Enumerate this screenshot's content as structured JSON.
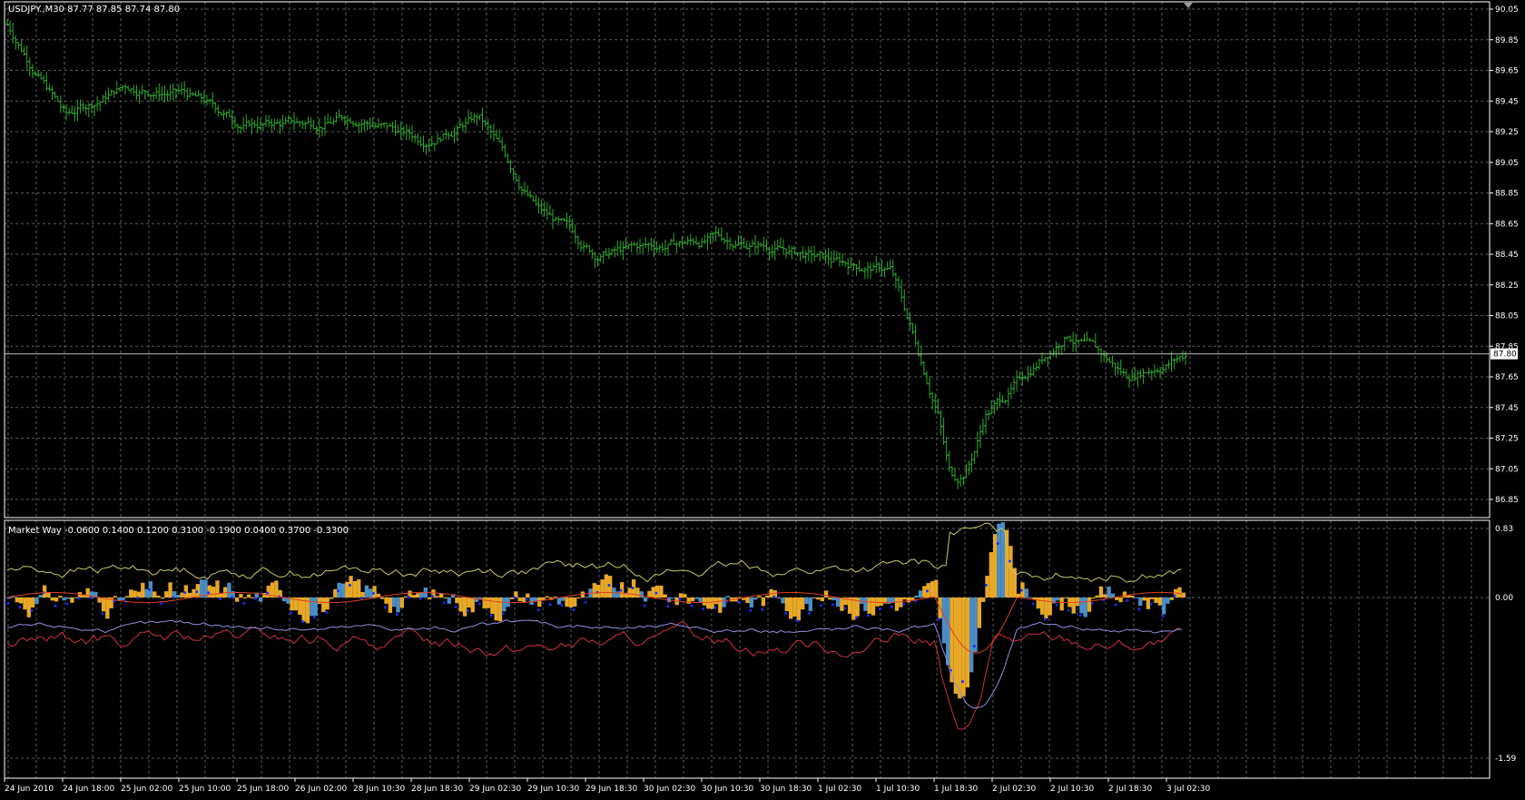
{
  "window": {
    "title": "USDJPY.,M30  87.77 87.85 87.74 87.80",
    "symbol": "USDJPY.,M30",
    "ohlc_text": "87.77 87.85 87.74 87.80"
  },
  "colors": {
    "background": "#000000",
    "grid": "#5a5a5a",
    "frame": "#ffffff",
    "bar": "#2ea82e",
    "current_price_line": "#c0c0c0",
    "hist_orange": "#e8a826",
    "hist_blue": "#4a8ec8",
    "dots": "#1a2cff",
    "line_yellow": "#c8c86a",
    "line_red": "#d03040",
    "line_orange_red": "#e04020",
    "line_purple": "#9090e0"
  },
  "price_pane": {
    "y_axis_labels": [
      "90.05",
      "89.85",
      "89.65",
      "89.45",
      "89.25",
      "89.05",
      "88.85",
      "88.65",
      "88.45",
      "88.25",
      "88.05",
      "87.85",
      "87.65",
      "87.45",
      "87.25",
      "87.05",
      "86.85"
    ],
    "current_price_label": "87.80",
    "current_price": 87.8
  },
  "indicator_pane": {
    "label": "Market Way -0.0600 0.1400 0.1200 0.3100 -0.1900 0.0400 0.3700 -0.3300",
    "y_axis_labels": [
      "0.83",
      "0.00",
      "-1.59"
    ],
    "max": 0.83,
    "min": -1.59
  },
  "time_axis": {
    "labels": [
      "24 Jun 2010",
      "24 Jun 18:00",
      "25 Jun 02:00",
      "25 Jun 10:00",
      "25 Jun 18:00",
      "26 Jun 02:00",
      "28 Jun 10:30",
      "28 Jun 18:30",
      "29 Jun 02:30",
      "29 Jun 10:30",
      "29 Jun 18:30",
      "30 Jun 02:30",
      "30 Jun 10:30",
      "30 Jun 18:30",
      "1 Jul 02:30",
      "1 Jul 10:30",
      "1 Jul 18:30",
      "2 Jul 02:30",
      "2 Jul 10:30",
      "2 Jul 18:30",
      "3 Jul 02:30"
    ]
  },
  "chart_data": {
    "type": "ohlc",
    "instrument": "USDJPY.",
    "timeframe": "M30",
    "close_path": [
      [
        "24 Jun 2010",
        89.95
      ],
      [
        "24 Jun 18:00",
        89.35
      ],
      [
        "25 Jun 02:00",
        89.55
      ],
      [
        "25 Jun 10:00",
        89.5
      ],
      [
        "25 Jun 18:00",
        89.3
      ],
      [
        "26 Jun 02:00",
        89.3
      ],
      [
        "28 Jun 10:30",
        89.35
      ],
      [
        "28 Jun 18:30",
        89.2
      ],
      [
        "29 Jun 02:30",
        89.35
      ],
      [
        "29 Jun 10:30",
        88.75
      ],
      [
        "29 Jun 18:30",
        88.45
      ],
      [
        "30 Jun 02:30",
        88.5
      ],
      [
        "30 Jun 10:30",
        88.55
      ],
      [
        "30 Jun 18:30",
        88.5
      ],
      [
        "1 Jul 02:30",
        88.4
      ],
      [
        "1 Jul 10:30",
        88.35
      ],
      [
        "1 Jul 18:30",
        87.2
      ],
      [
        "2 Jul 02:30",
        87.55
      ],
      [
        "2 Jul 10:30",
        87.95
      ],
      [
        "2 Jul 18:30",
        87.65
      ],
      [
        "3 Jul 02:30",
        87.8
      ]
    ],
    "ylim": [
      86.8,
      90.1
    ]
  }
}
